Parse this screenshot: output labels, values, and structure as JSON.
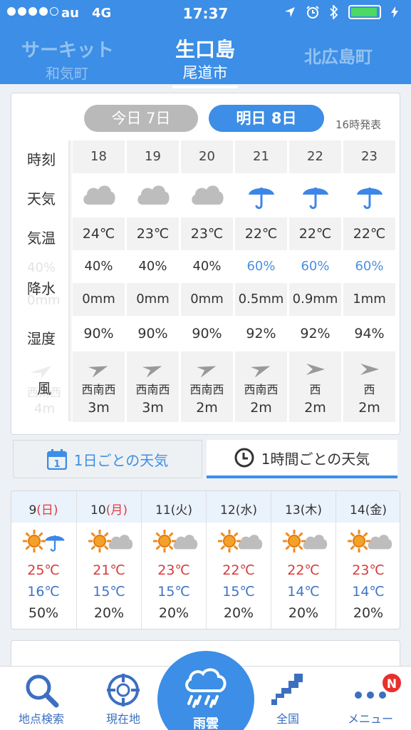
{
  "status": {
    "carrier": "au",
    "network": "4G",
    "time": "17:37"
  },
  "header": {
    "location": "生口島",
    "sub": "尾道市",
    "prev_location": "サーキット",
    "prev_sub": "和気町",
    "next_location": "北広島町"
  },
  "hourly": {
    "today_label": "今日 7日",
    "tomorrow_label": "明日 8日",
    "issued": "16時発表",
    "labels": {
      "time": "時刻",
      "weather": "天気",
      "temp": "気温",
      "precip": "降水",
      "humidity": "湿度",
      "wind": "風"
    },
    "ghost": {
      "prob": "40%",
      "amt": "0mm",
      "dir": "西南西",
      "spd": "4m"
    },
    "columns": [
      {
        "time": "18",
        "weather": "cloud-icon",
        "temp": "24℃",
        "prob": "40%",
        "amt": "0mm",
        "humidity": "90%",
        "wind_dir": "西南西",
        "wind_speed": "3m",
        "arrow_angle": 160
      },
      {
        "time": "19",
        "weather": "cloud-icon",
        "temp": "23℃",
        "prob": "40%",
        "amt": "0mm",
        "humidity": "90%",
        "wind_dir": "西南西",
        "wind_speed": "3m",
        "arrow_angle": 160
      },
      {
        "time": "20",
        "weather": "cloud-icon",
        "temp": "23℃",
        "prob": "40%",
        "amt": "0mm",
        "humidity": "90%",
        "wind_dir": "西南西",
        "wind_speed": "2m",
        "arrow_angle": 160
      },
      {
        "time": "21",
        "weather": "umbrella-icon",
        "temp": "22℃",
        "prob": "60%",
        "amt": "0.5mm",
        "humidity": "92%",
        "wind_dir": "西南西",
        "wind_speed": "2m",
        "arrow_angle": 160
      },
      {
        "time": "22",
        "weather": "umbrella-icon",
        "temp": "22℃",
        "prob": "60%",
        "amt": "0.9mm",
        "humidity": "92%",
        "wind_dir": "西",
        "wind_speed": "2m",
        "arrow_angle": 180
      },
      {
        "time": "23",
        "weather": "umbrella-icon",
        "temp": "22℃",
        "prob": "60%",
        "amt": "1mm",
        "humidity": "94%",
        "wind_dir": "西",
        "wind_speed": "2m",
        "arrow_angle": 180
      }
    ]
  },
  "tabs": {
    "daily": "1日ごとの天気",
    "hourly": "1時間ごとの天気",
    "calendar_day": "1"
  },
  "weekly": [
    {
      "day": "9",
      "dow": "(日)",
      "holiday": true,
      "icon": "sun-umbrella-icon",
      "hi": "25℃",
      "lo": "16℃",
      "pop": "50%"
    },
    {
      "day": "10",
      "dow": "(月)",
      "holiday": true,
      "icon": "sun-cloud-icon",
      "hi": "21℃",
      "lo": "15℃",
      "pop": "20%"
    },
    {
      "day": "11",
      "dow": "(火)",
      "holiday": false,
      "icon": "sun-cloud-icon",
      "hi": "23℃",
      "lo": "15℃",
      "pop": "20%"
    },
    {
      "day": "12",
      "dow": "(水)",
      "holiday": false,
      "icon": "sun-cloud-icon",
      "hi": "22℃",
      "lo": "15℃",
      "pop": "20%"
    },
    {
      "day": "13",
      "dow": "(木)",
      "holiday": false,
      "icon": "sun-cloud-icon",
      "hi": "22℃",
      "lo": "14℃",
      "pop": "20%"
    },
    {
      "day": "14",
      "dow": "(金)",
      "holiday": false,
      "icon": "sun-cloud-icon",
      "hi": "23℃",
      "lo": "14℃",
      "pop": "20%"
    }
  ],
  "nav": {
    "search": "地点検索",
    "current": "現在地",
    "rain": "雨雲",
    "national": "全国",
    "menu": "メニュー",
    "badge": "N"
  },
  "colors": {
    "primary": "#3c8ee6",
    "rain_blue": "#4a90e2",
    "high": "#d63b3b",
    "low": "#3f73c6",
    "sun": "#f08a1c"
  }
}
